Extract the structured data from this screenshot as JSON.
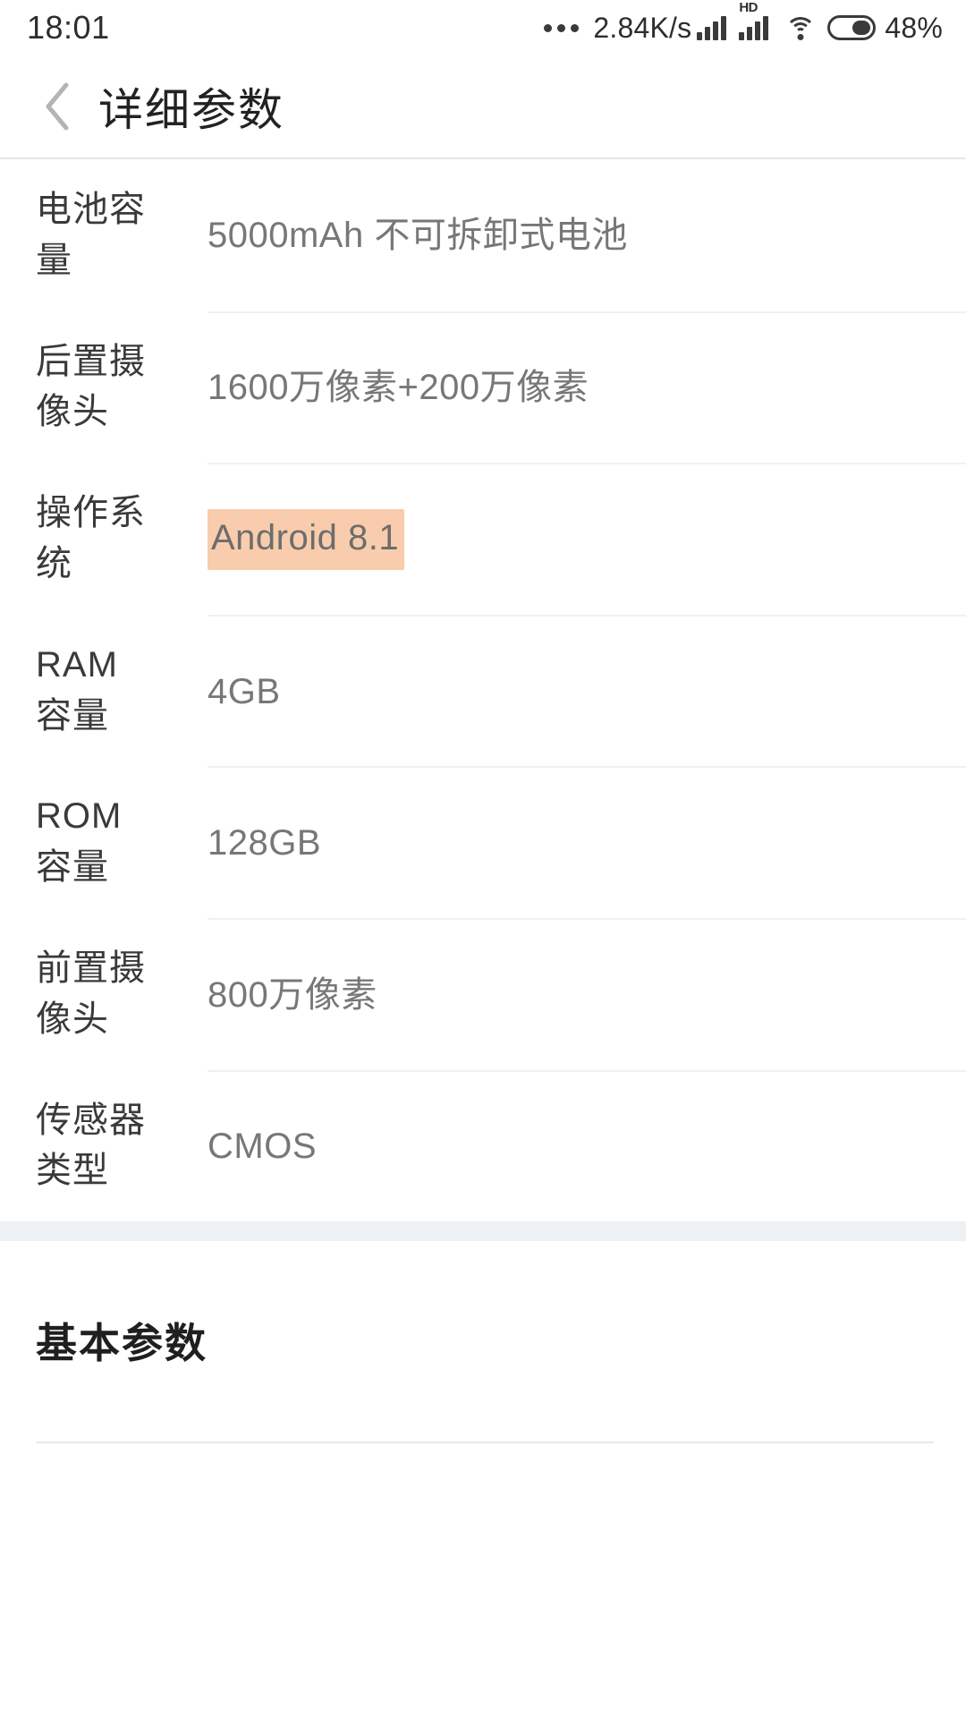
{
  "status_bar": {
    "time": "18:01",
    "network_speed": "2.84K/s",
    "hd_label": "HD",
    "battery_percent": "48%",
    "icons": [
      "more-dots-icon",
      "signal-bars-icon",
      "hd-signal-icon",
      "wifi-icon",
      "battery-icon"
    ]
  },
  "header": {
    "back_icon": "back-chevron-icon",
    "title": "详细参数"
  },
  "specs": {
    "rows": [
      {
        "label_lines": [
          "电池容",
          "量"
        ],
        "label": "电池容量",
        "value": "5000mAh  不可拆卸式电池",
        "highlighted": false
      },
      {
        "label_lines": [
          "后置摄",
          "像头"
        ],
        "label": "后置摄像头",
        "value": "1600万像素+200万像素",
        "highlighted": false
      },
      {
        "label_lines": [
          "操作系",
          "统"
        ],
        "label": "操作系统",
        "value": "Android 8.1",
        "highlighted": true
      },
      {
        "label_lines": [
          "RAM",
          "容量"
        ],
        "label": "RAM容量",
        "value": "4GB",
        "highlighted": false
      },
      {
        "label_lines": [
          "ROM",
          "容量"
        ],
        "label": "ROM容量",
        "value": "128GB",
        "highlighted": false
      },
      {
        "label_lines": [
          "前置摄",
          "像头"
        ],
        "label": "前置摄像头",
        "value": "800万像素",
        "highlighted": false
      },
      {
        "label_lines": [
          "传感器",
          "类型"
        ],
        "label": "传感器类型",
        "value": "CMOS",
        "highlighted": false
      }
    ]
  },
  "next_section": {
    "title": "基本参数"
  },
  "colors": {
    "highlight": "#f8ccac",
    "label_text": "#3a3a3a",
    "value_text": "#777777",
    "divider": "#f1f1f1",
    "band": "#eef1f4",
    "title_text": "#1f1f1f"
  }
}
